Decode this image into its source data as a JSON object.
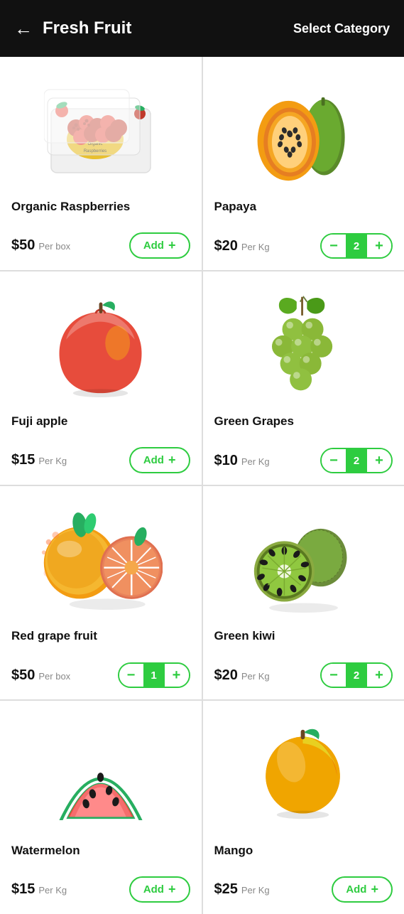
{
  "header": {
    "back_label": "←",
    "title": "Fresh Fruit",
    "select_category": "Select Category"
  },
  "products": [
    {
      "id": "organic-raspberries",
      "name": "Organic Raspberries",
      "price": "$50",
      "unit": "Per box",
      "qty": null,
      "has_qty": false,
      "fruit_type": "raspberries"
    },
    {
      "id": "papaya",
      "name": "Papaya",
      "price": "$20",
      "unit": "Per Kg",
      "qty": 2,
      "has_qty": true,
      "fruit_type": "papaya"
    },
    {
      "id": "fuji-apple",
      "name": "Fuji apple",
      "price": "$15",
      "unit": "Per Kg",
      "qty": null,
      "has_qty": false,
      "fruit_type": "apple"
    },
    {
      "id": "green-grapes",
      "name": "Green Grapes",
      "price": "$10",
      "unit": "Per Kg",
      "qty": 2,
      "has_qty": true,
      "fruit_type": "grapes"
    },
    {
      "id": "red-grapefruit",
      "name": "Red grape fruit",
      "price": "$50",
      "unit": "Per box",
      "qty": 1,
      "has_qty": true,
      "fruit_type": "grapefruit"
    },
    {
      "id": "green-kiwi",
      "name": "Green kiwi",
      "price": "$20",
      "unit": "Per Kg",
      "qty": 2,
      "has_qty": true,
      "fruit_type": "kiwi"
    },
    {
      "id": "watermelon",
      "name": "Watermelon",
      "price": "$15",
      "unit": "Per Kg",
      "qty": null,
      "has_qty": false,
      "fruit_type": "watermelon"
    },
    {
      "id": "mango",
      "name": "Mango",
      "price": "$25",
      "unit": "Per Kg",
      "qty": null,
      "has_qty": false,
      "fruit_type": "mango"
    }
  ],
  "buttons": {
    "add_label": "Add",
    "add_icon": "+",
    "minus_icon": "−",
    "plus_icon": "+"
  }
}
